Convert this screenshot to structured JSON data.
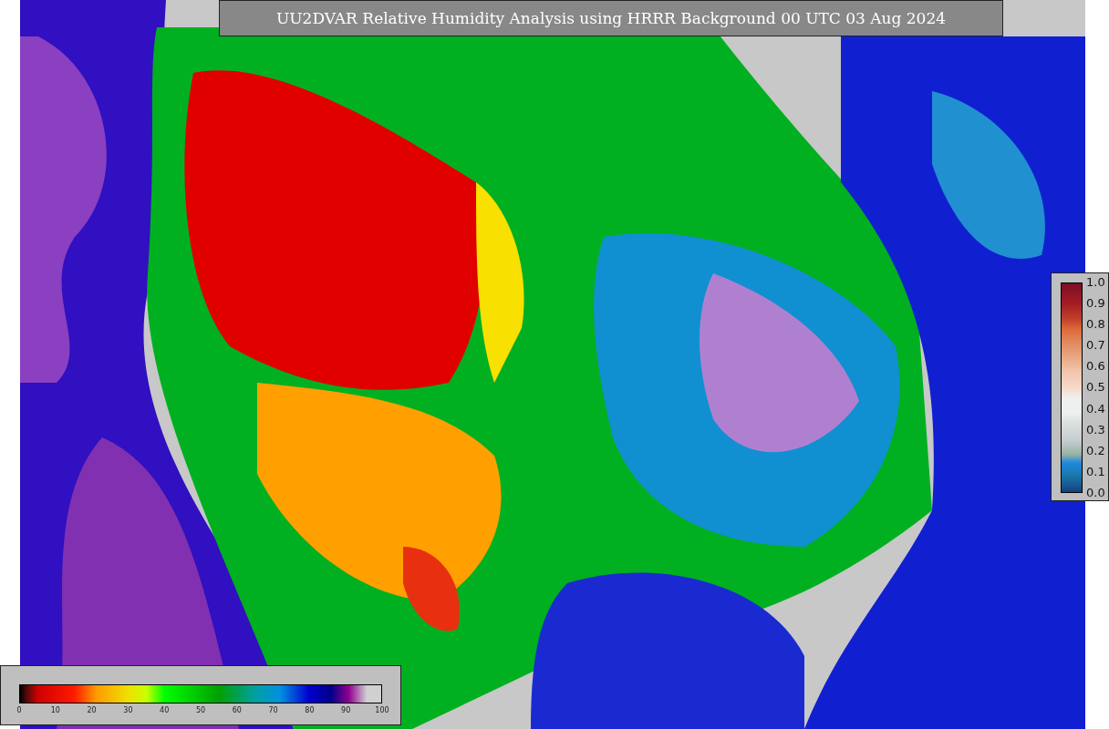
{
  "title": "UU2DVAR Relative Humidity Analysis using HRRR Background 00 UTC 03 Aug 2024",
  "error_colorbar": {
    "ticks": [
      "1.0",
      "0.9",
      "0.8",
      "0.7",
      "0.6",
      "0.5",
      "0.4",
      "0.3",
      "0.2",
      "0.1",
      "0.0"
    ]
  },
  "humidity_colorbar": {
    "ticks": [
      "0",
      "10",
      "20",
      "30",
      "40",
      "50",
      "60",
      "70",
      "80",
      "90",
      "100"
    ]
  }
}
